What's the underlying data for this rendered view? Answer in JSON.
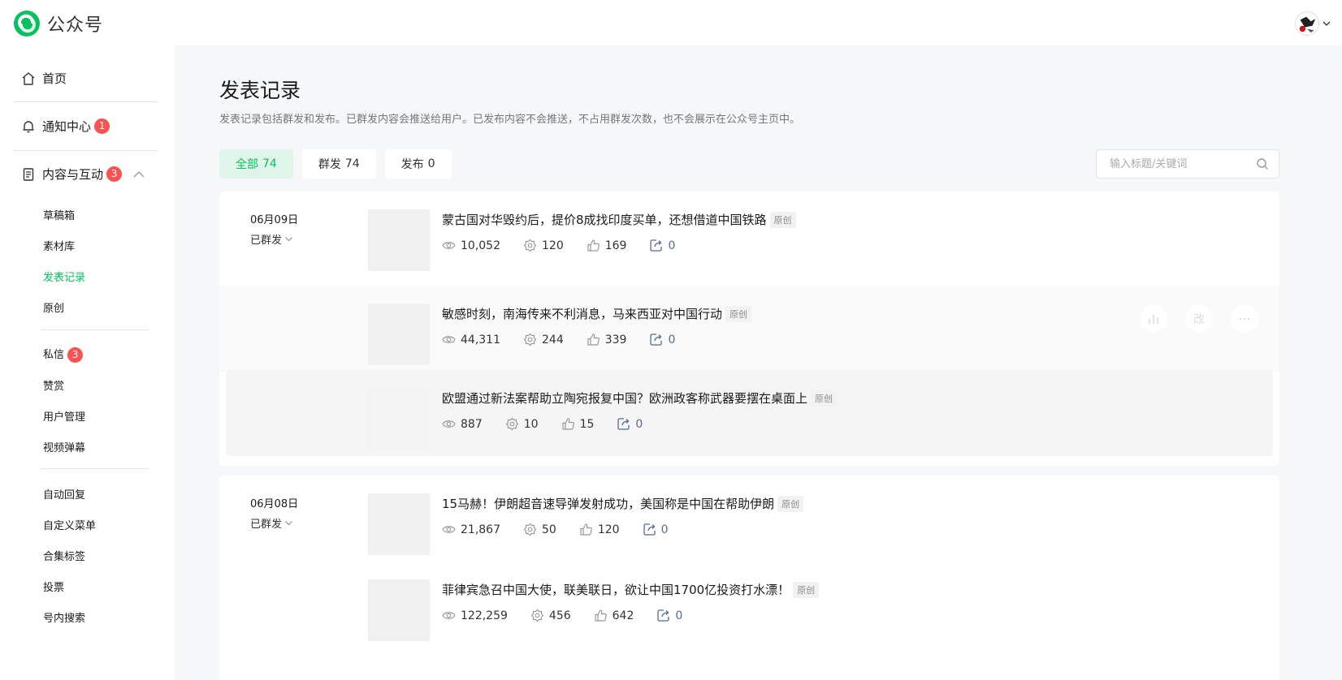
{
  "app": {
    "title": "公众号"
  },
  "sidebar": {
    "home": "首页",
    "notifications": {
      "label": "通知中心",
      "badge": "1"
    },
    "content": {
      "label": "内容与互动",
      "badge": "3"
    },
    "sub_items": [
      "草稿箱",
      "素材库",
      "发表记录",
      "原创"
    ],
    "messages": {
      "label": "私信",
      "badge": "3"
    },
    "more_items": [
      "赞赏",
      "用户管理",
      "视频弹幕"
    ],
    "tool_items": [
      "自动回复",
      "自定义菜单",
      "合集标签",
      "投票",
      "号内搜索"
    ]
  },
  "main": {
    "title": "发表记录",
    "description": "发表记录包括群发和发布。已群发内容会推送给用户。已发布内容不会推送，不占用群发次数，也不会展示在公众号主页中。",
    "tabs": [
      {
        "label": "全部",
        "count": "74"
      },
      {
        "label": "群发",
        "count": "74"
      },
      {
        "label": "发布",
        "count": "0"
      }
    ],
    "search": {
      "placeholder": "输入标题/关键词"
    },
    "original_tag": "原创",
    "actions": {
      "edit": "改"
    },
    "groups": [
      {
        "date": "06月09日",
        "status": "已群发",
        "articles": [
          {
            "title": "蒙古国对华毁约后，提价8成找印度买单，还想借道中国铁路",
            "views": "10,052",
            "recommends": "120",
            "likes": "169",
            "shares": "0"
          },
          {
            "title": "敏感时刻，南海传来不利消息，马来西亚对中国行动",
            "views": "44,311",
            "recommends": "244",
            "likes": "339",
            "shares": "0"
          },
          {
            "title": "欧盟通过新法案帮助立陶宛报复中国？欧洲政客称武器要摆在桌面上",
            "views": "887",
            "recommends": "10",
            "likes": "15",
            "shares": "0"
          }
        ]
      },
      {
        "date": "06月08日",
        "status": "已群发",
        "articles": [
          {
            "title": "15马赫！伊朗超音速导弹发射成功，美国称是中国在帮助伊朗",
            "views": "21,867",
            "recommends": "50",
            "likes": "120",
            "shares": "0"
          },
          {
            "title": "菲律宾急召中国大使，联美联日，欲让中国1700亿投资打水漂！",
            "views": "122,259",
            "recommends": "456",
            "likes": "642",
            "shares": "0"
          }
        ]
      }
    ]
  },
  "colors": {
    "accent": "#07c160",
    "badge": "#fa5151",
    "share": "#576b95"
  }
}
